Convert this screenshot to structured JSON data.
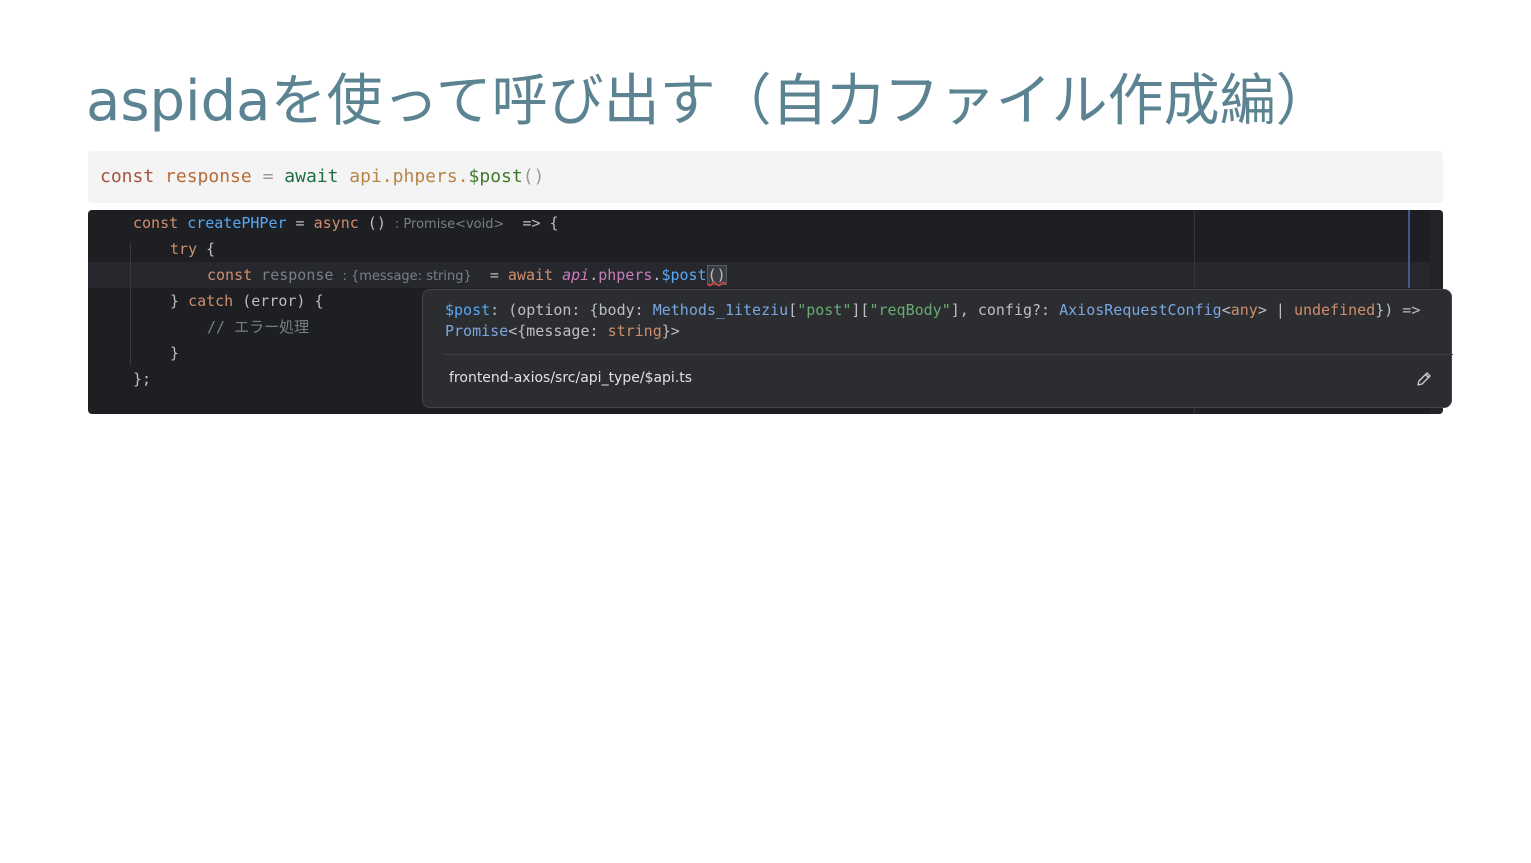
{
  "slide": {
    "title": "aspidaを使って呼び出す（自力ファイル作成編）"
  },
  "snippet": {
    "kw_const": "const",
    "var_response": "response",
    "op_eq": "=",
    "kw_await": "await",
    "obj_path": "api.phpers.",
    "fn_post": "$post",
    "parens": "()"
  },
  "editor": {
    "line1": {
      "kw_const": "const",
      "fn_name": "createPHPer",
      "op_eq": " = ",
      "kw_async": "async",
      "parens": " () ",
      "hint": ": Promise<void>",
      "arrow": "  => {"
    },
    "line2": {
      "kw_try": "try",
      "brace": " {"
    },
    "line3": {
      "kw_const": "const",
      "var_response": " response ",
      "hint": ": {message: string}",
      "op_eq": "  = ",
      "kw_await": "await",
      "api": "api",
      "dot1": ".",
      "phpers": "phpers",
      "dot2": ".",
      "post": "$post",
      "parens": "()"
    },
    "line4": {
      "close": "} ",
      "kw_catch": "catch",
      "rest": " (error) {"
    },
    "line5": {
      "comment": "// エラー処理"
    },
    "line6": {
      "close": "}"
    },
    "line7": {
      "close": "};"
    }
  },
  "popup": {
    "sig_fn": "$post",
    "sig_a": ": (option: {body: ",
    "sig_methods": "Methods_1iteziu",
    "sig_b": "[",
    "sig_str1": "\"post\"",
    "sig_c": "][",
    "sig_str2": "\"reqBody\"",
    "sig_d": "], config?: ",
    "sig_axios": "AxiosRequestConfig",
    "sig_e": "<",
    "sig_any": "any",
    "sig_f": "> | ",
    "sig_undef": "undefined",
    "sig_g": "}) =>",
    "sig_promise": "Promise",
    "sig_h": "<{message: ",
    "sig_string": "string",
    "sig_i": "}>",
    "path": "frontend-axios/src/api_type/$api.ts",
    "edit_icon": "pencil-icon"
  }
}
